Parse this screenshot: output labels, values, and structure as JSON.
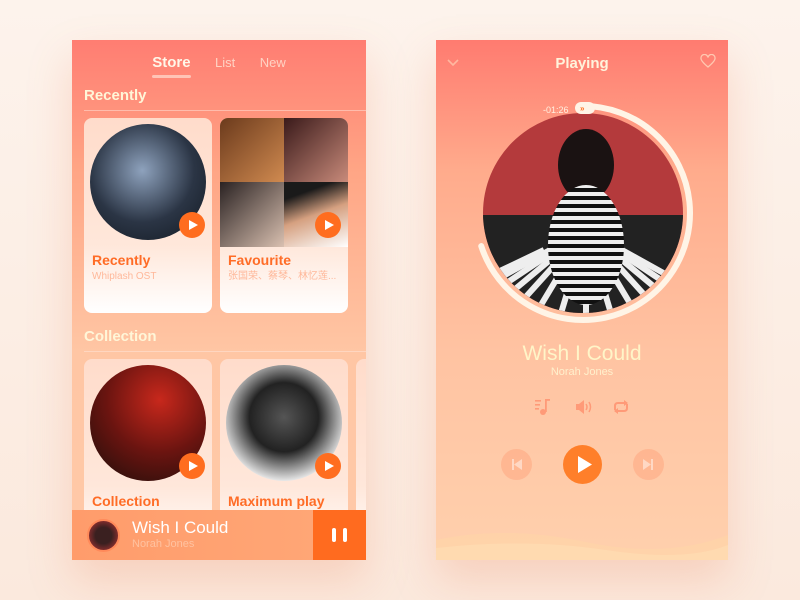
{
  "store": {
    "tabs": [
      {
        "label": "Store",
        "active": true
      },
      {
        "label": "List"
      },
      {
        "label": "New"
      }
    ],
    "sections": [
      {
        "title": "Recently",
        "cards": [
          {
            "title": "Recently",
            "subtitle": "Whiplash OST"
          },
          {
            "title": "Favourite",
            "subtitle": "张国荣、蔡琴、林忆莲..."
          }
        ]
      },
      {
        "title": "Collection",
        "cards": [
          {
            "title": "Collection",
            "subtitle": ""
          },
          {
            "title": "Maximum play",
            "subtitle": ""
          }
        ]
      }
    ],
    "mini_player": {
      "title": "Wish I Could",
      "artist": "Norah  Jones",
      "state": "playing"
    }
  },
  "playing": {
    "header": {
      "title": "Playing"
    },
    "time_remaining": "-01:26",
    "progress": 0.7,
    "title": "Wish I Could",
    "artist": "Norah  Jones",
    "icons": [
      "playlist-icon",
      "volume-icon",
      "repeat-icon"
    ]
  },
  "colors": {
    "accent": "#ff6d1f",
    "heading": "#fff6d8"
  }
}
